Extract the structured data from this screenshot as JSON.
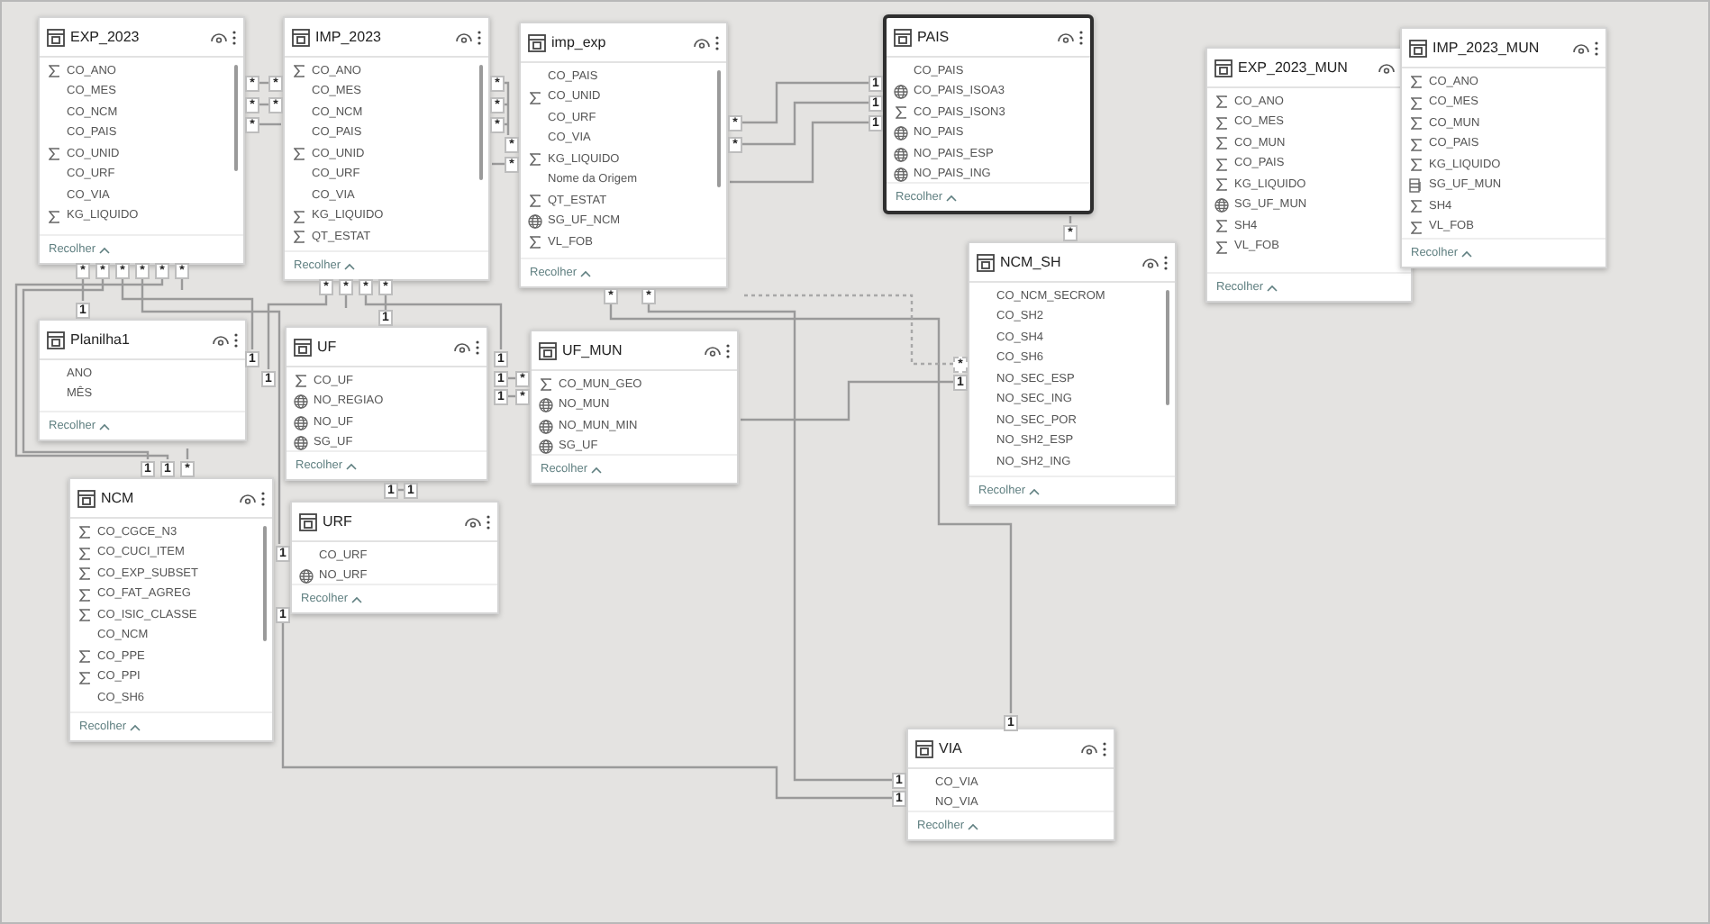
{
  "tables": [
    {
      "name": "EXP_2023",
      "selected": false,
      "scrollbar": true,
      "collapse": "Recolher",
      "fields": [
        {
          "name": "CO_ANO",
          "kind": "sum"
        },
        {
          "name": "CO_MES",
          "kind": "plain"
        },
        {
          "name": "CO_NCM",
          "kind": "plain"
        },
        {
          "name": "CO_PAIS",
          "kind": "plain"
        },
        {
          "name": "CO_UNID",
          "kind": "sum"
        },
        {
          "name": "CO_URF",
          "kind": "plain"
        },
        {
          "name": "CO_VIA",
          "kind": "plain"
        },
        {
          "name": "KG_LIQUIDO",
          "kind": "sum"
        }
      ]
    },
    {
      "name": "IMP_2023",
      "selected": false,
      "scrollbar": true,
      "collapse": "Recolher",
      "fields": [
        {
          "name": "CO_ANO",
          "kind": "sum"
        },
        {
          "name": "CO_MES",
          "kind": "plain"
        },
        {
          "name": "CO_NCM",
          "kind": "plain"
        },
        {
          "name": "CO_PAIS",
          "kind": "plain"
        },
        {
          "name": "CO_UNID",
          "kind": "sum"
        },
        {
          "name": "CO_URF",
          "kind": "plain"
        },
        {
          "name": "CO_VIA",
          "kind": "plain"
        },
        {
          "name": "KG_LIQUIDO",
          "kind": "sum"
        },
        {
          "name": "QT_ESTAT",
          "kind": "sum"
        }
      ]
    },
    {
      "name": "imp_exp",
      "selected": false,
      "scrollbar": true,
      "collapse": "Recolher",
      "fields": [
        {
          "name": "CO_PAIS",
          "kind": "plain"
        },
        {
          "name": "CO_UNID",
          "kind": "sum"
        },
        {
          "name": "CO_URF",
          "kind": "plain"
        },
        {
          "name": "CO_VIA",
          "kind": "plain"
        },
        {
          "name": "KG_LIQUIDO",
          "kind": "sum"
        },
        {
          "name": "Nome da Origem",
          "kind": "plain"
        },
        {
          "name": "QT_ESTAT",
          "kind": "sum"
        },
        {
          "name": "SG_UF_NCM",
          "kind": "geo"
        },
        {
          "name": "VL_FOB",
          "kind": "sum"
        }
      ]
    },
    {
      "name": "PAIS",
      "selected": true,
      "scrollbar": false,
      "collapse": "Recolher",
      "fields": [
        {
          "name": "CO_PAIS",
          "kind": "plain"
        },
        {
          "name": "CO_PAIS_ISOA3",
          "kind": "geo"
        },
        {
          "name": "CO_PAIS_ISON3",
          "kind": "sum"
        },
        {
          "name": "NO_PAIS",
          "kind": "geo"
        },
        {
          "name": "NO_PAIS_ESP",
          "kind": "geo"
        },
        {
          "name": "NO_PAIS_ING",
          "kind": "geo"
        }
      ]
    },
    {
      "name": "EXP_2023_MUN",
      "selected": false,
      "scrollbar": false,
      "collapse": "Recolher",
      "fields": [
        {
          "name": "CO_ANO",
          "kind": "sum"
        },
        {
          "name": "CO_MES",
          "kind": "sum"
        },
        {
          "name": "CO_MUN",
          "kind": "sum"
        },
        {
          "name": "CO_PAIS",
          "kind": "sum"
        },
        {
          "name": "KG_LIQUIDO",
          "kind": "sum"
        },
        {
          "name": "SG_UF_MUN",
          "kind": "geo"
        },
        {
          "name": "SH4",
          "kind": "sum"
        },
        {
          "name": "VL_FOB",
          "kind": "sum"
        }
      ]
    },
    {
      "name": "IMP_2023_MUN",
      "selected": false,
      "scrollbar": false,
      "collapse": "Recolher",
      "fields": [
        {
          "name": "CO_ANO",
          "kind": "sum"
        },
        {
          "name": "CO_MES",
          "kind": "sum"
        },
        {
          "name": "CO_MUN",
          "kind": "sum"
        },
        {
          "name": "CO_PAIS",
          "kind": "sum"
        },
        {
          "name": "KG_LIQUIDO",
          "kind": "sum"
        },
        {
          "name": "SG_UF_MUN",
          "kind": "calc"
        },
        {
          "name": "SH4",
          "kind": "sum"
        },
        {
          "name": "VL_FOB",
          "kind": "sum"
        }
      ]
    },
    {
      "name": "Planilha1",
      "selected": false,
      "scrollbar": false,
      "collapse": "Recolher",
      "fields": [
        {
          "name": "ANO",
          "kind": "plain"
        },
        {
          "name": "MÊS",
          "kind": "plain"
        }
      ]
    },
    {
      "name": "UF",
      "selected": false,
      "scrollbar": false,
      "collapse": "Recolher",
      "fields": [
        {
          "name": "CO_UF",
          "kind": "sum"
        },
        {
          "name": "NO_REGIAO",
          "kind": "geo"
        },
        {
          "name": "NO_UF",
          "kind": "geo"
        },
        {
          "name": "SG_UF",
          "kind": "geo"
        }
      ]
    },
    {
      "name": "UF_MUN",
      "selected": false,
      "scrollbar": false,
      "collapse": "Recolher",
      "fields": [
        {
          "name": "CO_MUN_GEO",
          "kind": "sum"
        },
        {
          "name": "NO_MUN",
          "kind": "geo"
        },
        {
          "name": "NO_MUN_MIN",
          "kind": "geo"
        },
        {
          "name": "SG_UF",
          "kind": "geo"
        }
      ]
    },
    {
      "name": "NCM",
      "selected": false,
      "scrollbar": true,
      "collapse": "Recolher",
      "fields": [
        {
          "name": "CO_CGCE_N3",
          "kind": "sum"
        },
        {
          "name": "CO_CUCI_ITEM",
          "kind": "sum"
        },
        {
          "name": "CO_EXP_SUBSET",
          "kind": "sum"
        },
        {
          "name": "CO_FAT_AGREG",
          "kind": "sum"
        },
        {
          "name": "CO_ISIC_CLASSE",
          "kind": "sum"
        },
        {
          "name": "CO_NCM",
          "kind": "plain"
        },
        {
          "name": "CO_PPE",
          "kind": "sum"
        },
        {
          "name": "CO_PPI",
          "kind": "sum"
        },
        {
          "name": "CO_SH6",
          "kind": "plain"
        }
      ]
    },
    {
      "name": "URF",
      "selected": false,
      "scrollbar": false,
      "collapse": "Recolher",
      "fields": [
        {
          "name": "CO_URF",
          "kind": "plain"
        },
        {
          "name": "NO_URF",
          "kind": "geo"
        }
      ]
    },
    {
      "name": "NCM_SH",
      "selected": false,
      "scrollbar": true,
      "collapse": "Recolher",
      "fields": [
        {
          "name": "CO_NCM_SECROM",
          "kind": "plain"
        },
        {
          "name": "CO_SH2",
          "kind": "plain"
        },
        {
          "name": "CO_SH4",
          "kind": "plain"
        },
        {
          "name": "CO_SH6",
          "kind": "plain"
        },
        {
          "name": "NO_SEC_ESP",
          "kind": "plain"
        },
        {
          "name": "NO_SEC_ING",
          "kind": "plain"
        },
        {
          "name": "NO_SEC_POR",
          "kind": "plain"
        },
        {
          "name": "NO_SH2_ESP",
          "kind": "plain"
        },
        {
          "name": "NO_SH2_ING",
          "kind": "plain"
        }
      ]
    },
    {
      "name": "VIA",
      "selected": false,
      "scrollbar": false,
      "collapse": "Recolher",
      "fields": [
        {
          "name": "CO_VIA",
          "kind": "plain"
        },
        {
          "name": "NO_VIA",
          "kind": "plain"
        }
      ]
    }
  ],
  "relationships": [
    {
      "active": true,
      "ends": [
        "*",
        "1"
      ]
    },
    {
      "active": true,
      "ends": [
        "*",
        "1"
      ]
    },
    {
      "active": true,
      "ends": [
        "*",
        "1"
      ]
    },
    {
      "active": true,
      "ends": [
        "*",
        "1"
      ]
    },
    {
      "active": true,
      "ends": [
        "*",
        "1"
      ]
    },
    {
      "active": true,
      "ends": [
        "*"
      ]
    },
    {
      "active": true,
      "ends": [
        "*",
        "*"
      ]
    },
    {
      "active": true,
      "ends": [
        "*",
        "*"
      ]
    },
    {
      "active": true,
      "ends": [
        "*"
      ]
    },
    {
      "active": true,
      "ends": [
        "*",
        "*"
      ]
    },
    {
      "active": true,
      "ends": [
        "*"
      ]
    },
    {
      "active": true,
      "ends": [
        "*"
      ]
    },
    {
      "active": true,
      "ends": [
        "*",
        "1"
      ]
    },
    {
      "active": true,
      "ends": [
        "*",
        "1"
      ]
    },
    {
      "active": true,
      "ends": [
        "1"
      ]
    },
    {
      "active": true,
      "ends": [
        "*",
        "1"
      ]
    },
    {
      "active": true,
      "ends": [
        "*"
      ]
    },
    {
      "active": true,
      "ends": [
        "*",
        "1"
      ]
    },
    {
      "active": true,
      "ends": [
        "*",
        "1"
      ]
    },
    {
      "active": true,
      "ends": [
        "1",
        "*"
      ]
    },
    {
      "active": true,
      "ends": [
        "1",
        "*"
      ]
    },
    {
      "active": true,
      "ends": [
        "*",
        "1"
      ]
    },
    {
      "active": true,
      "ends": [
        "*",
        "1"
      ]
    },
    {
      "active": true,
      "ends": [
        "1",
        "1"
      ]
    },
    {
      "active": false,
      "ends": [
        "*"
      ]
    },
    {
      "active": true,
      "ends": [
        "1"
      ]
    },
    {
      "active": true,
      "ends": [
        "*"
      ]
    },
    {
      "active": true,
      "ends": [
        "1",
        "1"
      ]
    },
    {
      "active": true,
      "ends": [
        "*"
      ]
    },
    {
      "active": true,
      "ends": [
        "*"
      ]
    }
  ]
}
